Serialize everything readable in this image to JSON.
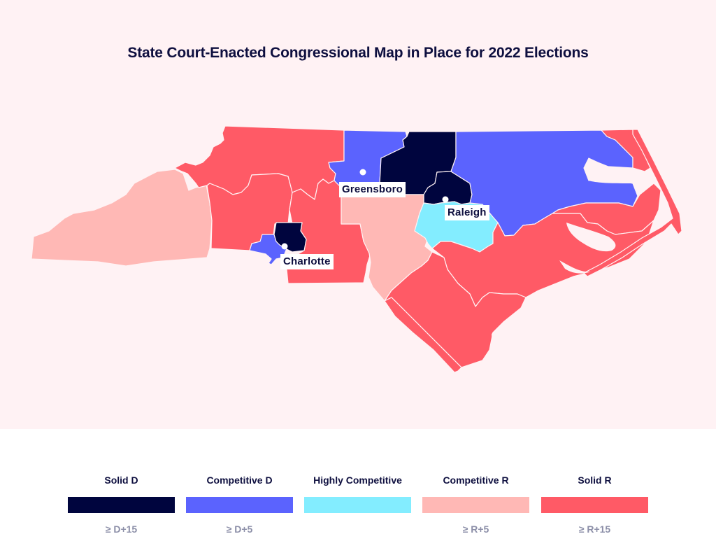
{
  "title": "State Court-Enacted Congressional Map in Place for 2022 Elections",
  "colors": {
    "solid_d": "#00053e",
    "competitive_d": "#5b63fe",
    "highly_competitive": "#83edff",
    "competitive_r": "#ffb8b5",
    "solid_r": "#ff5a66",
    "background": "#fff2f4"
  },
  "cities": [
    {
      "name": "Greensboro"
    },
    {
      "name": "Raleigh"
    },
    {
      "name": "Charlotte"
    }
  ],
  "districts": [
    {
      "id": "western-mountains",
      "rating": "Competitive R"
    },
    {
      "id": "northwest",
      "rating": "Solid R"
    },
    {
      "id": "foothills",
      "rating": "Solid R"
    },
    {
      "id": "piedmont-central",
      "rating": "Solid R"
    },
    {
      "id": "charlotte-suburbs",
      "rating": "Competitive D"
    },
    {
      "id": "charlotte-core",
      "rating": "Solid D"
    },
    {
      "id": "greensboro",
      "rating": "Competitive D"
    },
    {
      "id": "durham",
      "rating": "Solid D"
    },
    {
      "id": "raleigh-core",
      "rating": "Solid D"
    },
    {
      "id": "central-south",
      "rating": "Competitive R"
    },
    {
      "id": "wake-johnston",
      "rating": "Highly Competitive"
    },
    {
      "id": "northeast",
      "rating": "Competitive D"
    },
    {
      "id": "coastal-northeast",
      "rating": "Solid R"
    },
    {
      "id": "eastern",
      "rating": "Solid R"
    },
    {
      "id": "southeast",
      "rating": "Solid R"
    },
    {
      "id": "wilmington",
      "rating": "Solid R"
    },
    {
      "id": "sandhills",
      "rating": "Solid R"
    }
  ],
  "legend": [
    {
      "label": "Solid D",
      "threshold": "≥ D+15",
      "color": "#00053e"
    },
    {
      "label": "Competitive D",
      "threshold": "≥ D+5",
      "color": "#5b63fe"
    },
    {
      "label": "Highly Competitive",
      "threshold": "",
      "color": "#83edff"
    },
    {
      "label": "Competitive R",
      "threshold": "≥ R+5",
      "color": "#ffb8b5"
    },
    {
      "label": "Solid R",
      "threshold": "≥ R+15",
      "color": "#ff5a66"
    }
  ]
}
